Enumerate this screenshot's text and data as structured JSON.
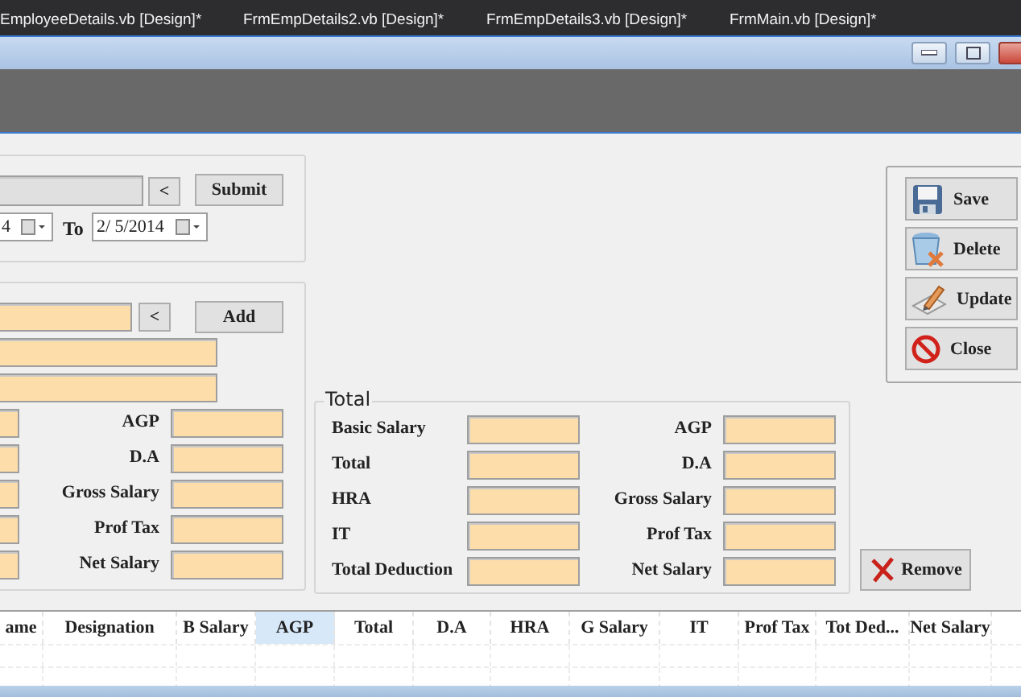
{
  "editor_tabs": [
    {
      "label": "EmployeeDetails.vb [Design]*"
    },
    {
      "label": "FrmEmpDetails2.vb [Design]*"
    },
    {
      "label": "FrmEmpDetails3.vb [Design]*"
    },
    {
      "label": "FrmMain.vb [Design]*"
    }
  ],
  "filter_group": {
    "back_button": "<",
    "submit_button": "Submit",
    "from_date": "4",
    "to_label": "To",
    "to_date": "2/ 5/2014"
  },
  "entry_group": {
    "back_button": "<",
    "add_button": "Add",
    "labels": [
      "AGP",
      "D.A",
      "Gross Salary",
      "Prof Tax",
      "Net Salary"
    ]
  },
  "total_group": {
    "title": "Total",
    "left_labels": [
      "Basic Salary",
      "Total",
      "HRA",
      "IT",
      "Total Deduction"
    ],
    "right_labels": [
      "AGP",
      "D.A",
      "Gross Salary",
      "Prof Tax",
      "Net Salary"
    ]
  },
  "remove_button": "Remove",
  "actions": [
    {
      "label": "Save",
      "kind": "save"
    },
    {
      "label": "Delete",
      "kind": "delete"
    },
    {
      "label": "Update",
      "kind": "update"
    },
    {
      "label": "Close",
      "kind": "close"
    }
  ],
  "grid": {
    "columns": [
      {
        "label": "ame",
        "selected": false
      },
      {
        "label": "Designation",
        "selected": false
      },
      {
        "label": "B Salary",
        "selected": false
      },
      {
        "label": "AGP",
        "selected": true
      },
      {
        "label": "Total",
        "selected": false
      },
      {
        "label": "D.A",
        "selected": false
      },
      {
        "label": "HRA",
        "selected": false
      },
      {
        "label": "G Salary",
        "selected": false
      },
      {
        "label": "IT",
        "selected": false
      },
      {
        "label": "Prof Tax",
        "selected": false
      },
      {
        "label": "Tot Ded...",
        "selected": false
      },
      {
        "label": "Net Salary",
        "selected": false
      }
    ]
  }
}
